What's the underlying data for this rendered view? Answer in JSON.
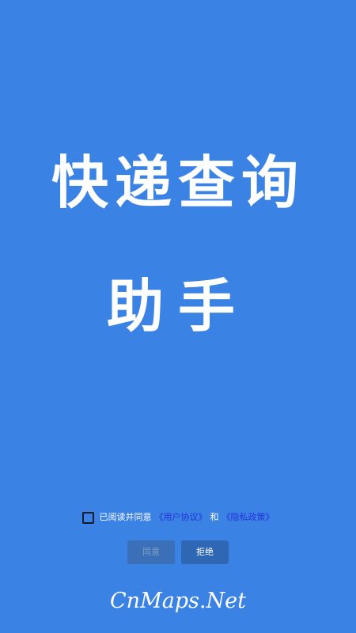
{
  "splash": {
    "title_line_1": "快递查询",
    "title_line_2": "助手"
  },
  "agreement": {
    "prefix": "已阅读并同意",
    "user_agreement_link": "《用户协议》",
    "conjunction": "和",
    "privacy_policy_link": "《隐私政策》",
    "checked": false
  },
  "buttons": {
    "agree_label": "同意",
    "refuse_label": "拒绝"
  },
  "footer": {
    "brand": "CnMaps.Net"
  },
  "colors": {
    "background": "#3a82e4",
    "link": "#2434d8",
    "button": "#2f67b4"
  }
}
